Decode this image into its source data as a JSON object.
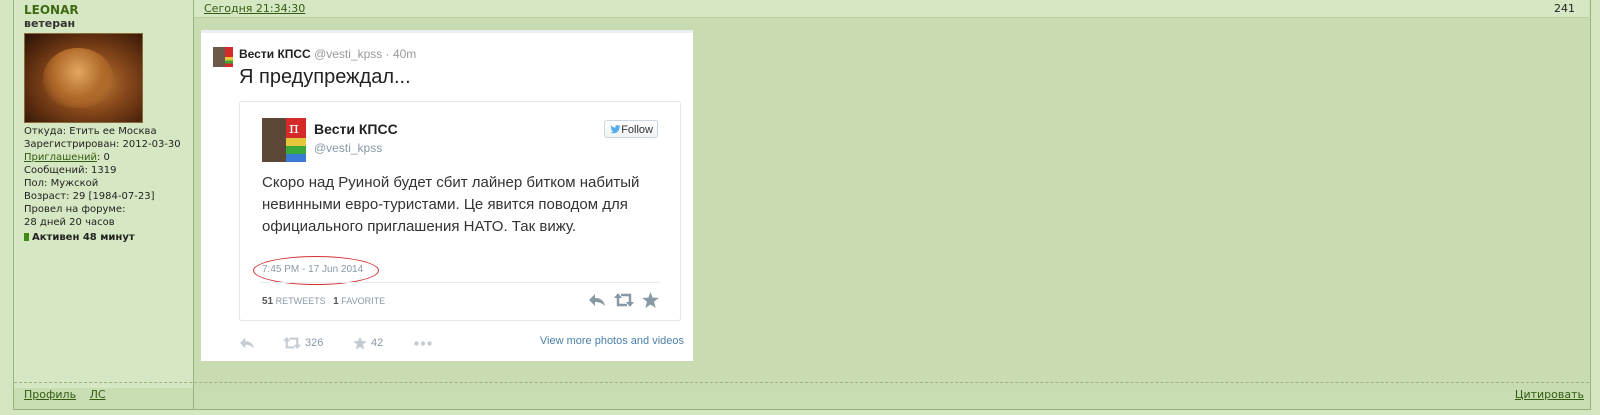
{
  "post": {
    "timestamp": "Сегодня 21:34:30",
    "number": "241"
  },
  "author": {
    "name": "LEONAR",
    "rank": "ветеран",
    "from_label": "Откуда: Етить ее Москва",
    "registered_label": "Зарегистрирован: 2012-03-30",
    "invites_link": "Приглашений",
    "invites_value": ": 0",
    "messages_label": "Сообщений: 1319",
    "gender_label": "Пол: Мужской",
    "age_label": "Возраст: 29 [1984-07-23]",
    "forum_time_label": "Провел на форуме:",
    "forum_time_value": "28 дней 20 часов",
    "active_label": "Активен 48 минут"
  },
  "tweet": {
    "name": "Вести КПСС",
    "meta": "@vesti_kpss · 40m",
    "text": "Я предупреждал...",
    "embedded": {
      "name": "Вести КПСС",
      "handle": "@vesti_kpss",
      "follow_label": "Follow",
      "body": "Скоро над Руиной будет сбит лайнер битком набитый невинными евро-туристами. Це явится поводом для официального приглашения НАТО. Так вижу.",
      "date": "7:45 PM - 17 Jun 2014",
      "retweets_count": "51",
      "retweets_label": "RETWEETS",
      "favorites_count": "1",
      "favorites_label": "FAVORITE"
    },
    "actions": {
      "retweet_count": "326",
      "favorite_count": "42",
      "more_link": "View more photos and videos"
    }
  },
  "footer": {
    "profile_link": "Профиль",
    "pm_link": "ЛС",
    "quote_link": "Цитировать"
  },
  "colors": {
    "background": "#d4e6c0",
    "link": "#335b12",
    "username": "#3e6a12",
    "twitter_link": "#4a7fa8",
    "highlight_oval": "#d43030"
  }
}
